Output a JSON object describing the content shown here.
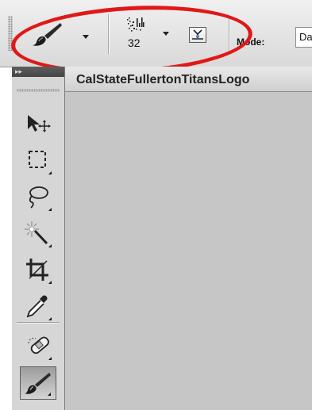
{
  "options_bar": {
    "brush_preset": {
      "icon": "brush-icon"
    },
    "brush_size": {
      "value": "32",
      "icon": "brush-size-icon"
    },
    "pressure_toggle": {
      "icon": "tablet-pressure-icon"
    },
    "mode": {
      "label": "Mode:",
      "value": "Da"
    }
  },
  "document": {
    "tab_title": "CalStateFullertonTitansLogo"
  },
  "toolbox": {
    "collapse_label": "▸▸",
    "tools": [
      {
        "name": "move-tool",
        "icon": "move-icon"
      },
      {
        "name": "marquee-tool",
        "icon": "marquee-icon"
      },
      {
        "name": "lasso-tool",
        "icon": "lasso-icon"
      },
      {
        "name": "magic-wand-tool",
        "icon": "magic-wand-icon"
      },
      {
        "name": "crop-tool",
        "icon": "crop-icon"
      },
      {
        "name": "eyedropper-tool",
        "icon": "eyedropper-icon"
      },
      {
        "name": "healing-brush-tool",
        "icon": "band-aid-icon"
      },
      {
        "name": "brush-tool",
        "icon": "brush-icon",
        "active": true
      }
    ]
  },
  "colors": {
    "annotation": "#e01818",
    "canvas": "#c6c6c6",
    "toolbox_bg": "#d6d6d6",
    "toolbox_header": "#4e4e4e"
  }
}
